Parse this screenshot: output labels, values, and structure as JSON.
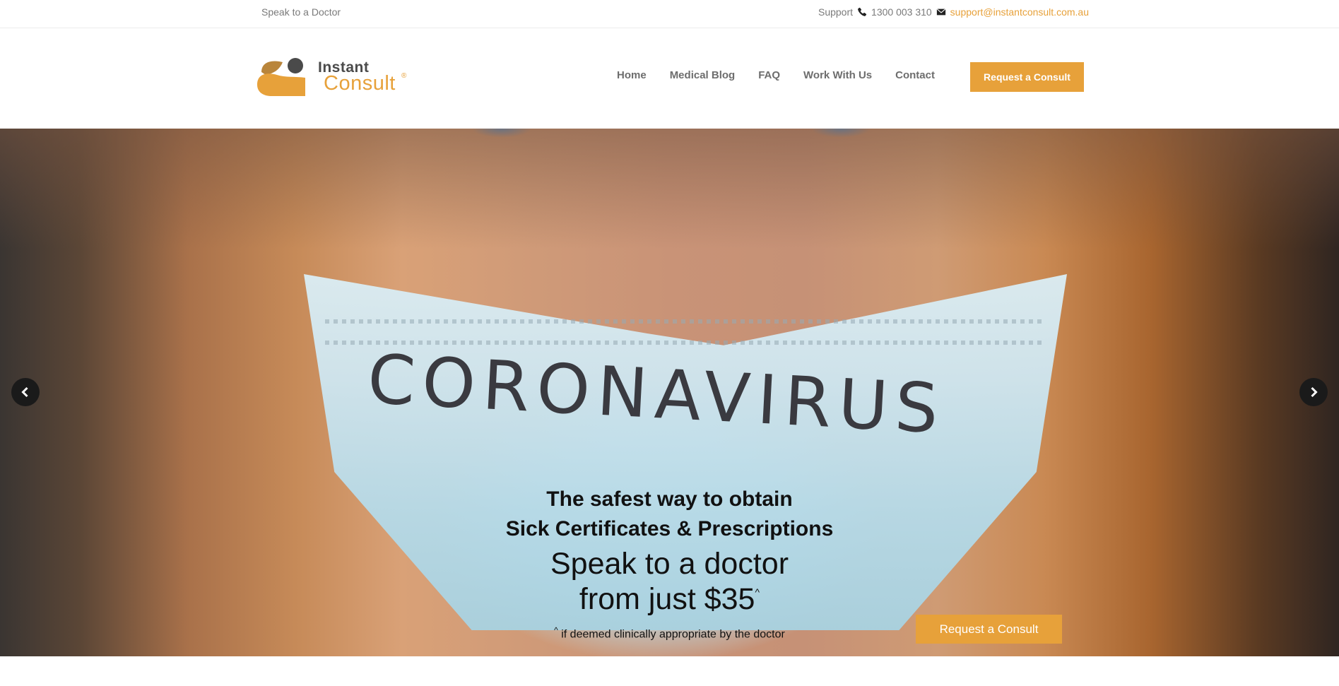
{
  "topbar": {
    "left_text": "Speak to a Doctor",
    "support_label": "Support",
    "phone": "1300 003 310",
    "email": "support@instantconsult.com.au"
  },
  "brand": {
    "name_line1": "Instant",
    "name_line2": "Consult",
    "mark": "®",
    "accent_color": "#e7a13a"
  },
  "nav": {
    "items": [
      {
        "label": "Home"
      },
      {
        "label": "Medical Blog"
      },
      {
        "label": "FAQ"
      },
      {
        "label": "Work With Us"
      },
      {
        "label": "Contact"
      }
    ],
    "cta_label": "Request a Consult"
  },
  "hero": {
    "mask_text": "CORONAVIRUS",
    "headline_line1": "The safest way to obtain",
    "headline_line2": "Sick Certificates & Prescriptions",
    "subhead_line1": "Speak to a doctor",
    "subhead_line2": "from just $35",
    "subhead_sup": "^",
    "note_sup": "^",
    "note": "if deemed clinically appropriate by the doctor",
    "cta_label": "Request a Consult",
    "prev_icon": "chevron-left-icon",
    "next_icon": "chevron-right-icon"
  }
}
